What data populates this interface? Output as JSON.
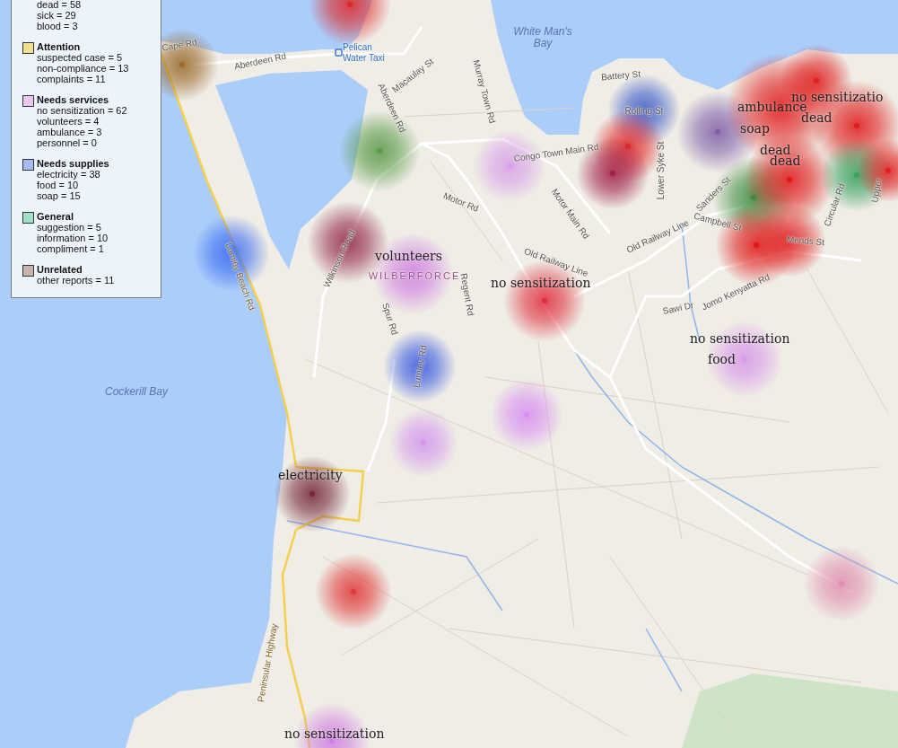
{
  "legend": {
    "groups": [
      {
        "items": [
          "dead = 58",
          "sick = 29",
          "blood = 3"
        ]
      },
      {
        "title": "Attention",
        "color": "#f0df90",
        "items": [
          "suspected case = 5",
          "non-compliance = 13",
          "complaints = 11"
        ]
      },
      {
        "title": "Needs services",
        "color": "#e8c8f0",
        "items": [
          "no sensitization = 62",
          "volunteers = 4",
          "ambulance = 3",
          "personnel = 0"
        ]
      },
      {
        "title": "Needs supplies",
        "color": "#a8bcf4",
        "items": [
          "electricity = 38",
          "food = 10",
          "soap = 15"
        ]
      },
      {
        "title": "General",
        "color": "#a4e0c8",
        "items": [
          "suggestion = 5",
          "information = 10",
          "compliment = 1"
        ]
      },
      {
        "title": "Unrelated",
        "color": "#c8b4ac",
        "items": [
          "other reports = 11"
        ]
      }
    ]
  },
  "map_labels": [
    {
      "text": "Cape Rd",
      "kind": "road"
    },
    {
      "text": "Aberdeen Rd",
      "kind": "road"
    },
    {
      "text": "Pelican Water Taxi",
      "kind": "place"
    },
    {
      "text": "Macaulay St",
      "kind": "road"
    },
    {
      "text": "White Man's Bay",
      "kind": "water"
    },
    {
      "text": "Murray Town Rd",
      "kind": "road"
    },
    {
      "text": "Aberdeen Rd",
      "kind": "road"
    },
    {
      "text": "Congo Town Main Rd",
      "kind": "road"
    },
    {
      "text": "Motor Rd",
      "kind": "road"
    },
    {
      "text": "Motor Main Rd",
      "kind": "road"
    },
    {
      "text": "Battery St",
      "kind": "road"
    },
    {
      "text": "Rolling St",
      "kind": "road"
    },
    {
      "text": "Lower Syke St",
      "kind": "road"
    },
    {
      "text": "Sanders St",
      "kind": "road"
    },
    {
      "text": "Campbell St",
      "kind": "road"
    },
    {
      "text": "Mends St",
      "kind": "road"
    },
    {
      "text": "Circular Rd",
      "kind": "road"
    },
    {
      "text": "Upper",
      "kind": "road"
    },
    {
      "text": "Old Railway Line",
      "kind": "road"
    },
    {
      "text": "Old Railway Line",
      "kind": "road"
    },
    {
      "text": "Wilkinson Road",
      "kind": "road"
    },
    {
      "text": "WILBERFORCE",
      "kind": "district"
    },
    {
      "text": "Regent Rd",
      "kind": "road"
    },
    {
      "text": "Spur Rd",
      "kind": "road"
    },
    {
      "text": "Lumley Rd",
      "kind": "road"
    },
    {
      "text": "Lumley Beach Rd",
      "kind": "highway"
    },
    {
      "text": "Sawi Dr",
      "kind": "road"
    },
    {
      "text": "Jomo Kenyatta Rd",
      "kind": "road"
    },
    {
      "text": "Cockerill Bay",
      "kind": "water"
    },
    {
      "text": "Peninsular Highway",
      "kind": "highway"
    }
  ],
  "hotspots": [
    {
      "color": "#e02828"
    },
    {
      "color": "#9a6a2c"
    },
    {
      "color": "#5a9a48"
    },
    {
      "color": "#d8a0e8"
    },
    {
      "color": "#3c6cf0"
    },
    {
      "color": "#922848"
    },
    {
      "color": "#d080e0"
    },
    {
      "color": "#e03040"
    },
    {
      "color": "#3858e0"
    },
    {
      "color": "#d890f0"
    },
    {
      "color": "#d498ec"
    },
    {
      "color": "#742838"
    },
    {
      "color": "#e03838"
    },
    {
      "color": "#d898e8"
    },
    {
      "color": "#e090b0"
    },
    {
      "color": "#d080e0"
    },
    {
      "color": "#3a58c8"
    },
    {
      "color": "#e02828"
    },
    {
      "color": "#a02048"
    },
    {
      "color": "#8060a8"
    },
    {
      "color": "#e01818"
    },
    {
      "color": "#e02020"
    },
    {
      "color": "#e01c1c"
    },
    {
      "color": "#3c8c40"
    },
    {
      "color": "#e01818"
    },
    {
      "color": "#e01818"
    },
    {
      "color": "#e02020"
    },
    {
      "color": "#38a060"
    },
    {
      "color": "#e02020"
    }
  ],
  "report_labels": [
    {
      "text": "no sensitizatio"
    },
    {
      "text": "ambulance"
    },
    {
      "text": "dead"
    },
    {
      "text": "soap"
    },
    {
      "text": "dead"
    },
    {
      "text": "dead"
    },
    {
      "text": "volunteers"
    },
    {
      "text": "no sensitization"
    },
    {
      "text": "no sensitization"
    },
    {
      "text": "food"
    },
    {
      "text": "electricity"
    },
    {
      "text": "no sensitization"
    }
  ]
}
